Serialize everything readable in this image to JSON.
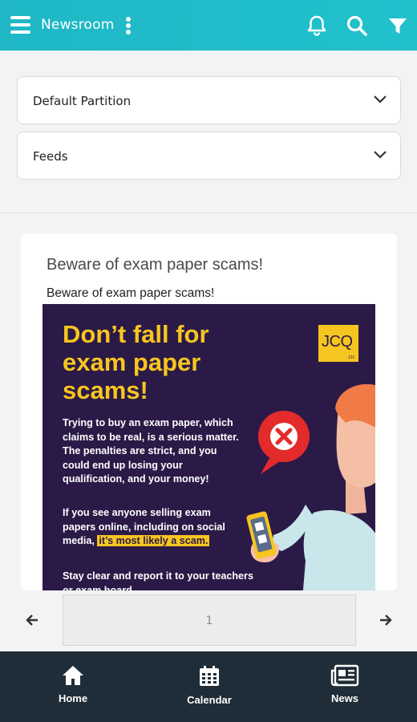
{
  "app": {
    "title": "Newsroom"
  },
  "filters": {
    "partition": {
      "value": "Default Partition"
    },
    "feeds": {
      "value": "Feeds"
    }
  },
  "article": {
    "title": "Beware of exam paper scams!",
    "subtitle": "Beware of exam paper scams!",
    "poster": {
      "headline": "Don’t fall for exam paper scams!",
      "logo": "JCQ",
      "logo_small": "CIC",
      "paragraph1": "Trying to buy an exam paper, which claims to be real, is a serious matter. The penalties are strict, and you could end up losing your qualification, and your money!",
      "paragraph2_start": "If you see anyone selling exam papers online, including on social media,",
      "paragraph2_highlight": "it’s most likely a scam.",
      "paragraph3": "Stay clear and report it to your teachers or exam board."
    }
  },
  "pager": {
    "page": "1"
  },
  "bottom_nav": {
    "home": "Home",
    "calendar": "Calendar",
    "news": "News"
  },
  "colors": {
    "header": "#21c1cc",
    "poster_bg": "#2b1a47",
    "poster_accent": "#f7c520",
    "nav_bg": "#1e2d38"
  }
}
